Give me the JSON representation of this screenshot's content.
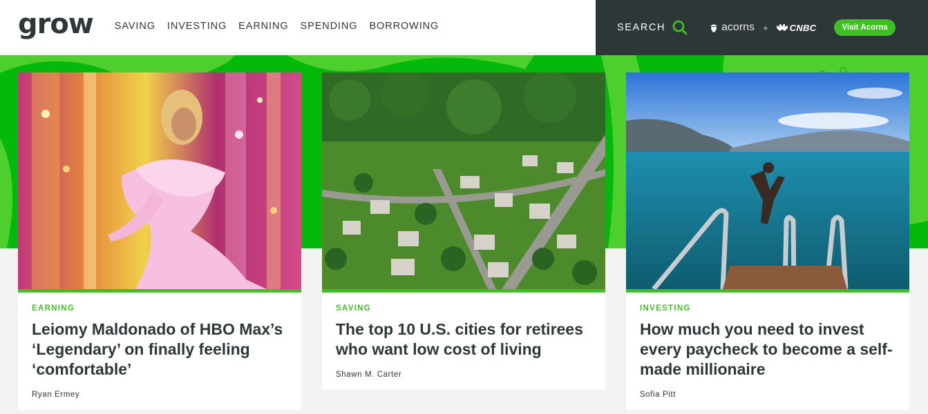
{
  "header": {
    "logo": "grow",
    "nav": [
      "SAVING",
      "INVESTING",
      "EARNING",
      "SPENDING",
      "BORROWING"
    ],
    "search_label": "SEARCH",
    "partner_acorns": "acorns",
    "partner_plus": "+",
    "partner_cnbc": "CNBC",
    "visit_label": "Visit Acorns"
  },
  "colors": {
    "accent_green": "#3fbf21",
    "band_green": "#04b90c",
    "dark": "#2e3737"
  },
  "cards": [
    {
      "category": "EARNING",
      "title": "Leiomy Maldonado of HBO Max’s ‘Legendary’ on finally feeling ‘comfortable’",
      "author": "Ryan Ermey",
      "image": "performer-on-stage-photo"
    },
    {
      "category": "SAVING",
      "title": "The top 10 U.S. cities for retirees who want low cost of living",
      "author": "Shawn M. Carter",
      "image": "aerial-suburb-photo"
    },
    {
      "category": "INVESTING",
      "title": "How much you need to invest every paycheck to become a self-made millionaire",
      "author": "Sofia Pitt",
      "image": "lake-jump-photo"
    }
  ]
}
